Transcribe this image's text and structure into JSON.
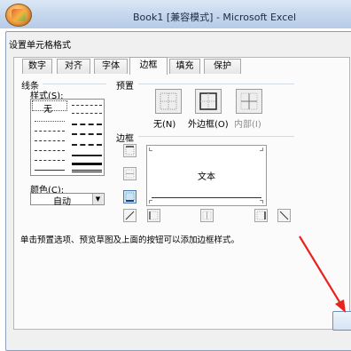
{
  "app_title": "Book1  [兼容模式]  -  Microsoft Excel",
  "dialog_title": "设置单元格格式",
  "tabs": [
    {
      "label": "数字",
      "active": false
    },
    {
      "label": "对齐",
      "active": false
    },
    {
      "label": "字体",
      "active": false
    },
    {
      "label": "边框",
      "active": true
    },
    {
      "label": "填充",
      "active": false
    },
    {
      "label": "保护",
      "active": false
    }
  ],
  "line": {
    "group_label": "线条",
    "style_label": "样式(S):",
    "style_none": "无",
    "color_label": "颜色(C):",
    "color_value": "自动"
  },
  "presets": {
    "group_label": "预置",
    "none": "无(N)",
    "outline": "外边框(O)",
    "inside": "内部(I)"
  },
  "border": {
    "group_label": "边框",
    "preview_text": "文本"
  },
  "hint": "单击预置选项、预览草图及上面的按钮可以添加边框样式。",
  "colors": {
    "title_bar": "#c4d6ee",
    "dialog_bg": "#f0f0f0",
    "annotation_arrow": "#e8231f"
  }
}
